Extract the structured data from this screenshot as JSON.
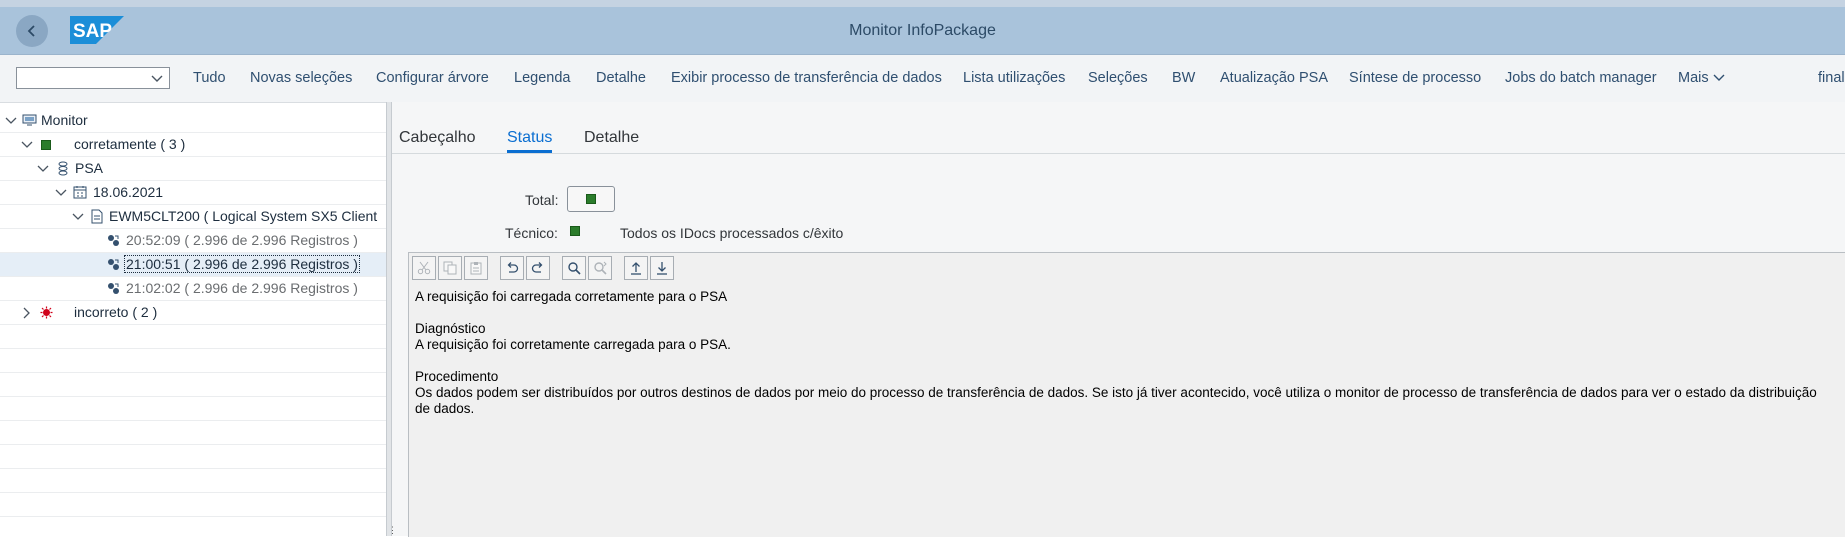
{
  "shell": {
    "title": "Monitor InfoPackage",
    "logo_text": "SAP"
  },
  "toolbar": {
    "select_value": "",
    "items": [
      "Tudo",
      "Novas seleções",
      "Configurar árvore",
      "Legenda",
      "Detalhe",
      "Exibir processo de transferência de dados",
      "Lista utilizações",
      "Seleções",
      "BW",
      "Atualização PSA",
      "Síntese de processo",
      "Jobs do batch manager",
      "Mais",
      "final"
    ]
  },
  "tree": {
    "monitor": "Monitor",
    "correct": "corretamente ( 3 )",
    "psa": "PSA",
    "date": "18.06.2021",
    "system": "EWM5CLT200 ( Logical System SX5 Client",
    "req1": "20:52:09 ( 2.996 de 2.996 Registros )",
    "req2": "21:00:51 ( 2.996 de 2.996 Registros )",
    "req3": "21:02:02 ( 2.996 de 2.996 Registros )",
    "incorrect": "incorreto ( 2 )"
  },
  "tabs": [
    "Cabeçalho",
    "Status",
    "Detalhe"
  ],
  "active_tab": "Status",
  "status": {
    "total_label": "Total:",
    "technical_label": "Técnico:",
    "technical_text": "Todos os IDocs processados c/êxito",
    "status_color": "#2b7c2b"
  },
  "message": {
    "line1": "A requisição foi carregada corretamente para o PSA",
    "diagnostic_title": "Diagnóstico",
    "diagnostic_text": "A requisição foi corretamente carregada para o PSA.",
    "procedure_title": "Procedimento",
    "procedure_text": "Os dados podem ser distribuídos por outros destinos de dados por meio do processo de transferência de dados. Se isto já tiver acontecido, você utiliza o monitor de processo de transferência de dados para ver o estado da distribuição de dados."
  },
  "editor_icons": [
    "cut-icon",
    "copy-icon",
    "paste-icon",
    "undo-icon",
    "redo-icon",
    "find-icon",
    "find-next-icon",
    "upload-icon",
    "download-icon"
  ]
}
